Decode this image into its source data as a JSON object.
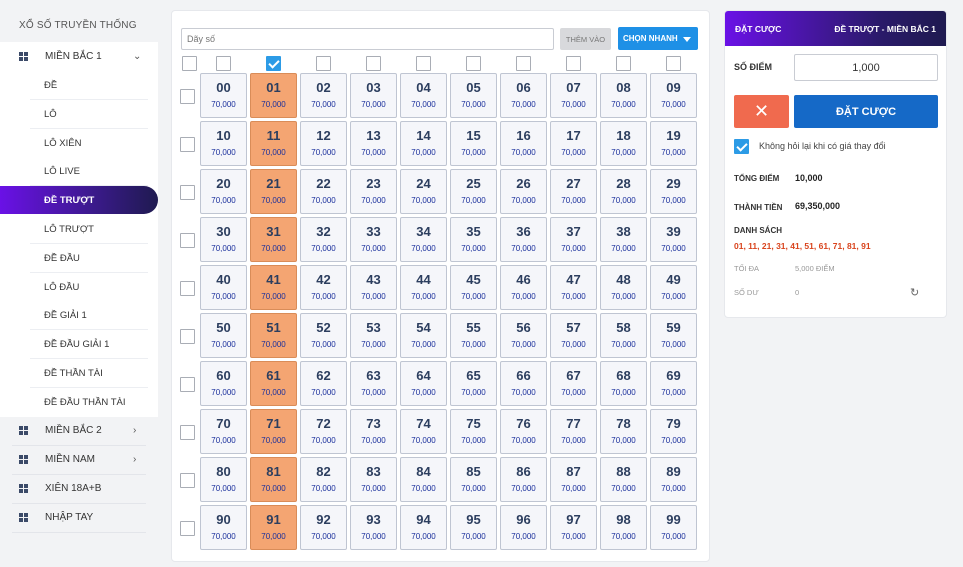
{
  "sidebar": {
    "title": "XỔ SỐ TRUYỀN THỐNG",
    "regions": [
      {
        "label": "MIỀN BẮC 1",
        "chevron": "⌄"
      },
      {
        "label": "MIỀN BẮC 2",
        "chevron": "›"
      },
      {
        "label": "MIỀN NAM",
        "chevron": "›"
      },
      {
        "label": "XIÊN 18A+B",
        "chevron": ""
      },
      {
        "label": "NHẬP TAY",
        "chevron": ""
      }
    ],
    "items": [
      {
        "label": "ĐỀ"
      },
      {
        "label": "LÔ"
      },
      {
        "label": "LÔ XIÊN"
      },
      {
        "label": "LÔ LIVE"
      },
      {
        "label": "ĐỀ TRƯỢT"
      },
      {
        "label": "LÔ TRƯỢT"
      },
      {
        "label": "ĐỀ ĐẦU"
      },
      {
        "label": "LÔ ĐẦU"
      },
      {
        "label": "ĐỀ GIẢI 1"
      },
      {
        "label": "ĐỀ ĐẦU GIẢI 1"
      },
      {
        "label": "ĐỀ THẦN TÀI"
      },
      {
        "label": "ĐỀ ĐẦU THẦN TÀI"
      }
    ],
    "active_item": 4
  },
  "main": {
    "sequence_placeholder": "Dãy số",
    "add_label": "THÊM VÀO",
    "quick_label": "CHỌN NHANH",
    "price": "70,000",
    "selected_column": 1,
    "numbers": [
      [
        "00",
        "01",
        "02",
        "03",
        "04",
        "05",
        "06",
        "07",
        "08",
        "09"
      ],
      [
        "10",
        "11",
        "12",
        "13",
        "14",
        "15",
        "16",
        "17",
        "18",
        "19"
      ],
      [
        "20",
        "21",
        "22",
        "23",
        "24",
        "25",
        "26",
        "27",
        "28",
        "29"
      ],
      [
        "30",
        "31",
        "32",
        "33",
        "34",
        "35",
        "36",
        "37",
        "38",
        "39"
      ],
      [
        "40",
        "41",
        "42",
        "43",
        "44",
        "45",
        "46",
        "47",
        "48",
        "49"
      ],
      [
        "50",
        "51",
        "52",
        "53",
        "54",
        "55",
        "56",
        "57",
        "58",
        "59"
      ],
      [
        "60",
        "61",
        "62",
        "63",
        "64",
        "65",
        "66",
        "67",
        "68",
        "69"
      ],
      [
        "70",
        "71",
        "72",
        "73",
        "74",
        "75",
        "76",
        "77",
        "78",
        "79"
      ],
      [
        "80",
        "81",
        "82",
        "83",
        "84",
        "85",
        "86",
        "87",
        "88",
        "89"
      ],
      [
        "90",
        "91",
        "92",
        "93",
        "94",
        "95",
        "96",
        "97",
        "98",
        "99"
      ]
    ]
  },
  "bet_panel": {
    "header_left": "ĐẶT CƯỢC",
    "header_right": "ĐỀ TRƯỢT - MIỀN BẮC 1",
    "score_label": "SỐ ĐIỂM",
    "score_value": "1,000",
    "cancel_symbol": "✕",
    "bet_label": "ĐẶT CƯỢC",
    "no_ask_label": "Không hỏi lại khi có giá thay đổi",
    "no_ask_checked": true,
    "total_points_label": "TỔNG ĐIỂM",
    "total_points_value": "10,000",
    "amount_label": "THÀNH TIỀN",
    "amount_value": "69,350,000",
    "list_label": "DANH SÁCH",
    "list_value": "01, 11, 21, 31, 41, 51, 61, 71, 81, 91",
    "max_label": "TỐI ĐA",
    "max_value": "5,000 ĐIỂM",
    "balance_label": "SỐ DƯ",
    "balance_value": "0",
    "refresh_icon": "refresh-icon"
  }
}
